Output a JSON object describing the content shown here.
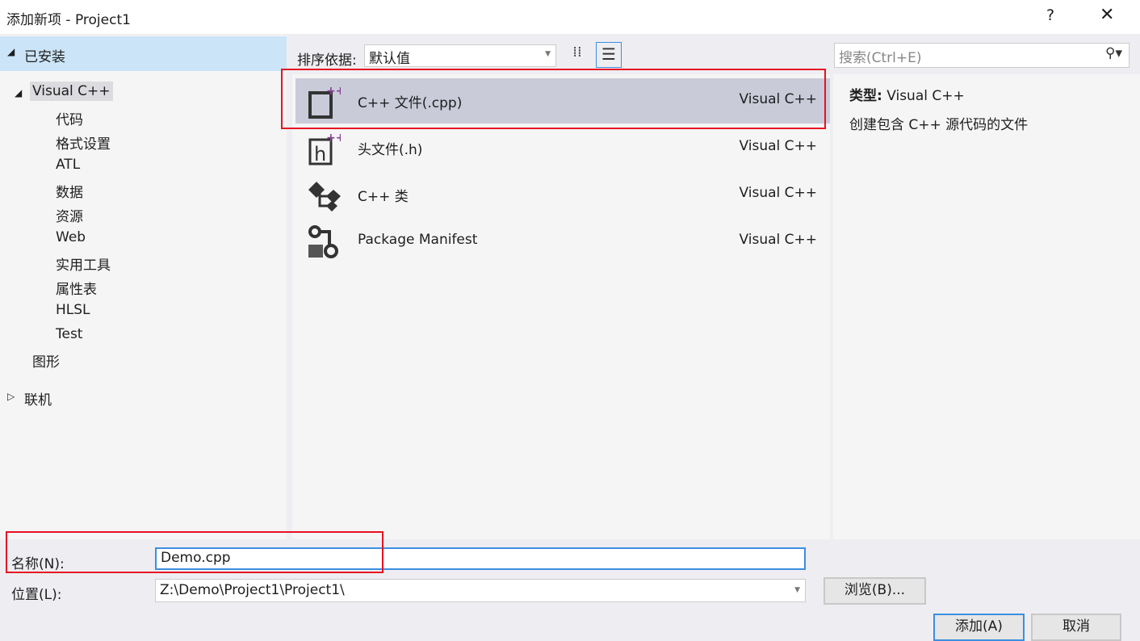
{
  "window": {
    "title": "添加新项 - Project1",
    "help": "?",
    "close": "✕"
  },
  "sidebar": {
    "installed": "已安装",
    "visual_cpp": "Visual C++",
    "children": [
      "代码",
      "格式设置",
      "ATL",
      "数据",
      "资源",
      "Web",
      "实用工具",
      "属性表",
      "HLSL",
      "Test"
    ],
    "graphics": "图形",
    "online": "联机"
  },
  "toolbar": {
    "sort_label": "排序依据:",
    "sort_value": "默认值",
    "search_placeholder": "搜索(Ctrl+E)"
  },
  "templates": [
    {
      "name": "C++ 文件(.cpp)",
      "type": "Visual C++",
      "icon": "cpp-file-icon",
      "selected": true
    },
    {
      "name": "头文件(.h)",
      "type": "Visual C++",
      "icon": "header-file-icon"
    },
    {
      "name": "C++ 类",
      "type": "Visual C++",
      "icon": "cpp-class-icon"
    },
    {
      "name": "Package Manifest",
      "type": "Visual C++",
      "icon": "package-manifest-icon"
    }
  ],
  "details": {
    "type_label": "类型:",
    "type_value": "Visual C++",
    "description": "创建包含 C++ 源代码的文件"
  },
  "form": {
    "name_label": "名称(N):",
    "name_value": "Demo.cpp",
    "location_label": "位置(L):",
    "location_value": "Z:\\Demo\\Project1\\Project1\\",
    "browse": "浏览(B)...",
    "add": "添加(A)",
    "cancel": "取消"
  },
  "colors": {
    "accent": "#3c8ee0",
    "highlight": "#e81123",
    "selected_row": "#c9cbd9"
  }
}
